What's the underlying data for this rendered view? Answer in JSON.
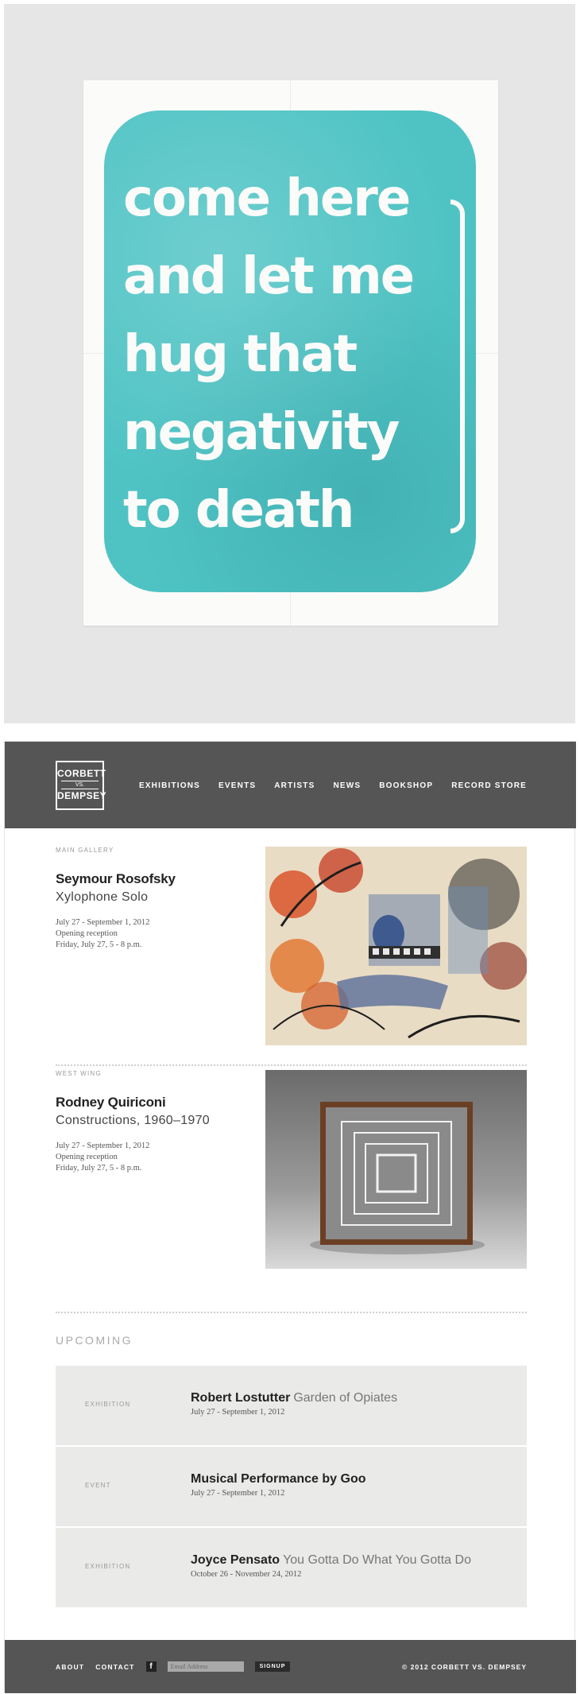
{
  "poster": {
    "lines": [
      "come here",
      "and let me",
      "hug that",
      "negativity",
      "to death"
    ],
    "color": "#4fc3c4"
  },
  "header": {
    "logo": {
      "line1": "CORBETT",
      "line2": "VS.",
      "line3": "DEMPSEY"
    },
    "nav": [
      "EXHIBITIONS",
      "EVENTS",
      "ARTISTS",
      "NEWS",
      "BOOKSHOP",
      "RECORD STORE"
    ]
  },
  "exhibitions": [
    {
      "location": "MAIN GALLERY",
      "artist": "Seymour Rosofsky",
      "title": "Xylophone Solo",
      "dates": "July 27 - September 1, 2012",
      "reception_label": "Opening reception",
      "reception_time": "Friday, July 27, 5 - 8 p.m."
    },
    {
      "location": "WEST WING",
      "artist": "Rodney Quiriconi",
      "title": "Constructions, 1960–1970",
      "dates": "July 27 - September 1, 2012",
      "reception_label": "Opening reception",
      "reception_time": "Friday, July 27, 5 - 8 p.m."
    }
  ],
  "upcoming": {
    "heading": "UPCOMING",
    "items": [
      {
        "type": "EXHIBITION",
        "name": "Robert Lostutter",
        "subtitle": "Garden of Opiates",
        "dates": "July 27 - September 1, 2012"
      },
      {
        "type": "EVENT",
        "name": "Musical Performance by Goo",
        "subtitle": "",
        "dates": "July 27 - September 1, 2012"
      },
      {
        "type": "EXHIBITION",
        "name": "Joyce Pensato",
        "subtitle": "You Gotta Do What You Gotta Do",
        "dates": "October 26 - November 24, 2012"
      }
    ]
  },
  "footer": {
    "about": "ABOUT",
    "contact": "CONTACT",
    "facebook_glyph": "f",
    "email_placeholder": "Email Address",
    "signup": "SIGNUP",
    "copyright": "© 2012 CORBETT VS. DEMPSEY"
  },
  "colors": {
    "header_bg": "#555555",
    "row_bg": "#eaeae8",
    "panel_bg": "#e6e6e6"
  }
}
